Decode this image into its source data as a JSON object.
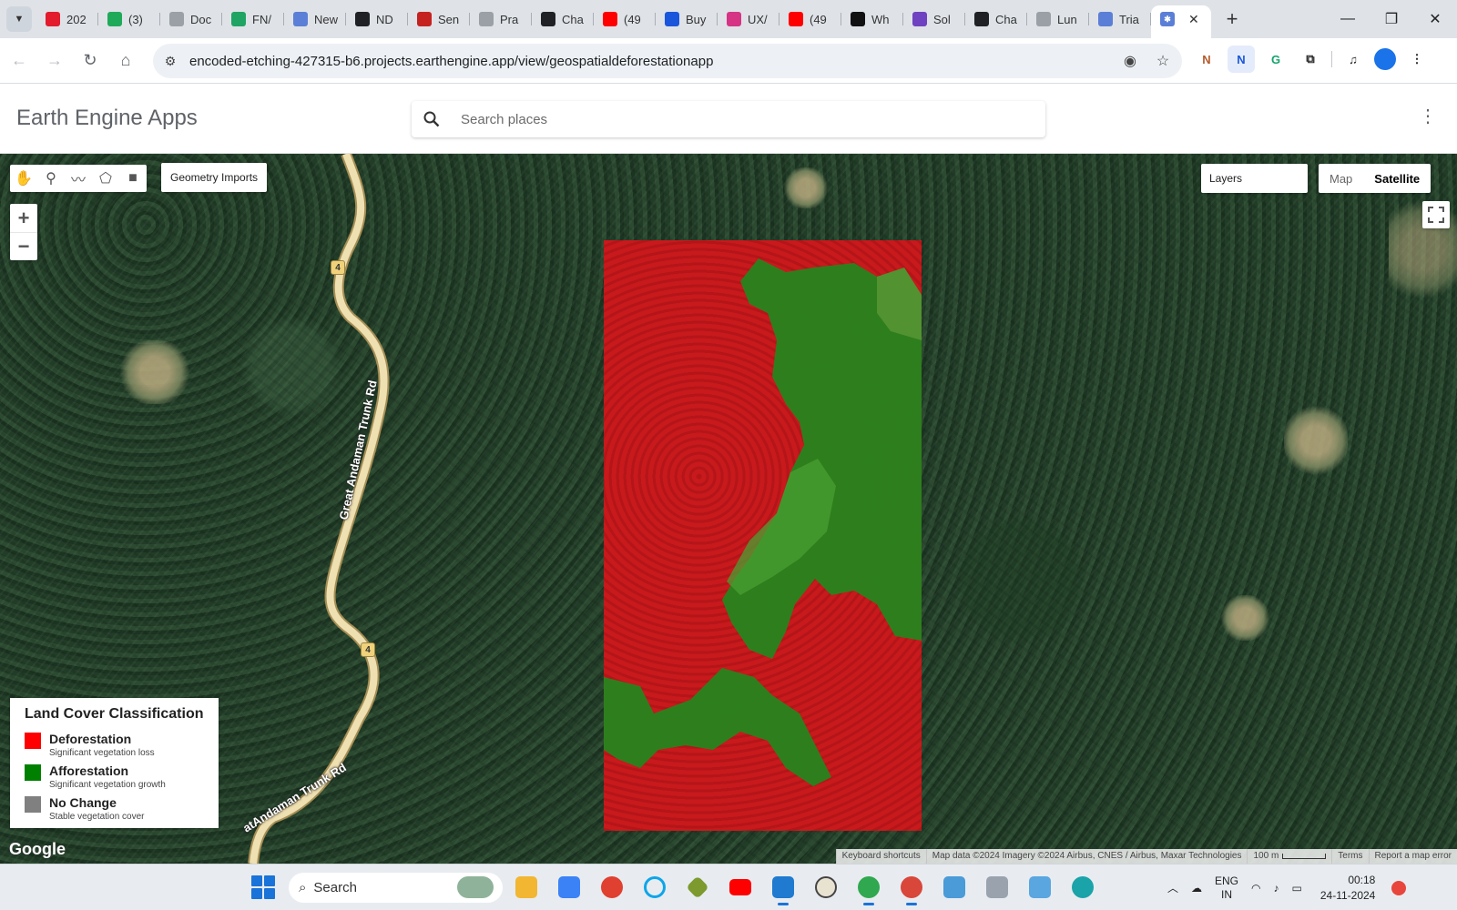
{
  "browser": {
    "tabs": [
      {
        "title": "202",
        "color": "#e21b2d",
        "icon": "opera-icon"
      },
      {
        "title": "(3)",
        "color": "#1faa59",
        "icon": "whatsapp-icon"
      },
      {
        "title": "Doc",
        "color": "#9aa0a6",
        "icon": "globe-icon"
      },
      {
        "title": "FN/",
        "color": "#1fa463",
        "icon": "drive-icon"
      },
      {
        "title": "New",
        "color": "#5b7fd6",
        "icon": "earthengine-icon"
      },
      {
        "title": "ND",
        "color": "#202124",
        "icon": "app-icon"
      },
      {
        "title": "Sen",
        "color": "#c5221f",
        "icon": "gmail-icon"
      },
      {
        "title": "Pra",
        "color": "#9aa0a6",
        "icon": "github-icon"
      },
      {
        "title": "Cha",
        "color": "#202124",
        "icon": "chatgpt-icon"
      },
      {
        "title": "(49",
        "color": "#ff0000",
        "icon": "youtube-icon"
      },
      {
        "title": "Buy",
        "color": "#1a56db",
        "icon": "linkedin-learning-icon"
      },
      {
        "title": "UX/",
        "color": "#d63384",
        "icon": "p-icon"
      },
      {
        "title": "(49",
        "color": "#ff0000",
        "icon": "youtube-icon"
      },
      {
        "title": "Wh",
        "color": "#111111",
        "icon": "medium-icon"
      },
      {
        "title": "Sol",
        "color": "#6f42c1",
        "icon": "brain-icon"
      },
      {
        "title": "Cha",
        "color": "#202124",
        "icon": "chatgpt-icon"
      },
      {
        "title": "Lun",
        "color": "#9aa0a6",
        "icon": "github-icon"
      },
      {
        "title": "Tria",
        "color": "#5b7fd6",
        "icon": "earthengine-icon"
      }
    ],
    "active_tab_close": "✕",
    "new_tab": "+",
    "url": "encoded-etching-427315-b6.projects.earthengine.app/view/geospatialdeforestationapp"
  },
  "app": {
    "title": "Earth Engine Apps",
    "search_placeholder": "Search places"
  },
  "map": {
    "geometry_imports_label": "Geometry Imports",
    "zoom_in": "+",
    "zoom_out": "−",
    "layers_label": "Layers",
    "maptype_map": "Map",
    "maptype_satellite": "Satellite",
    "road_shield": "4",
    "road_name": "Great Andaman Trunk Rd",
    "road_name_partial": "atAndaman Trunk Rd",
    "google_logo": "Google",
    "attribution": {
      "keyboard": "Keyboard shortcuts",
      "data": "Map data ©2024 Imagery ©2024 Airbus, CNES / Airbus, Maxar Technologies",
      "scale": "100 m",
      "terms": "Terms",
      "report": "Report a map error"
    },
    "overlay_colors": {
      "deforestation": "#c8191c",
      "afforestation": "#1e8a1e",
      "no_change": "#808080"
    }
  },
  "legend": {
    "title": "Land Cover Classification",
    "items": [
      {
        "label": "Deforestation",
        "desc": "Significant vegetation loss",
        "color": "#ff0000"
      },
      {
        "label": "Afforestation",
        "desc": "Significant vegetation growth",
        "color": "#008000"
      },
      {
        "label": "No Change",
        "desc": "Stable vegetation cover",
        "color": "#808080"
      }
    ]
  },
  "taskbar": {
    "search_label": "Search",
    "lang_1": "ENG",
    "lang_2": "IN",
    "time": "00:18",
    "date": "24-11-2024"
  }
}
